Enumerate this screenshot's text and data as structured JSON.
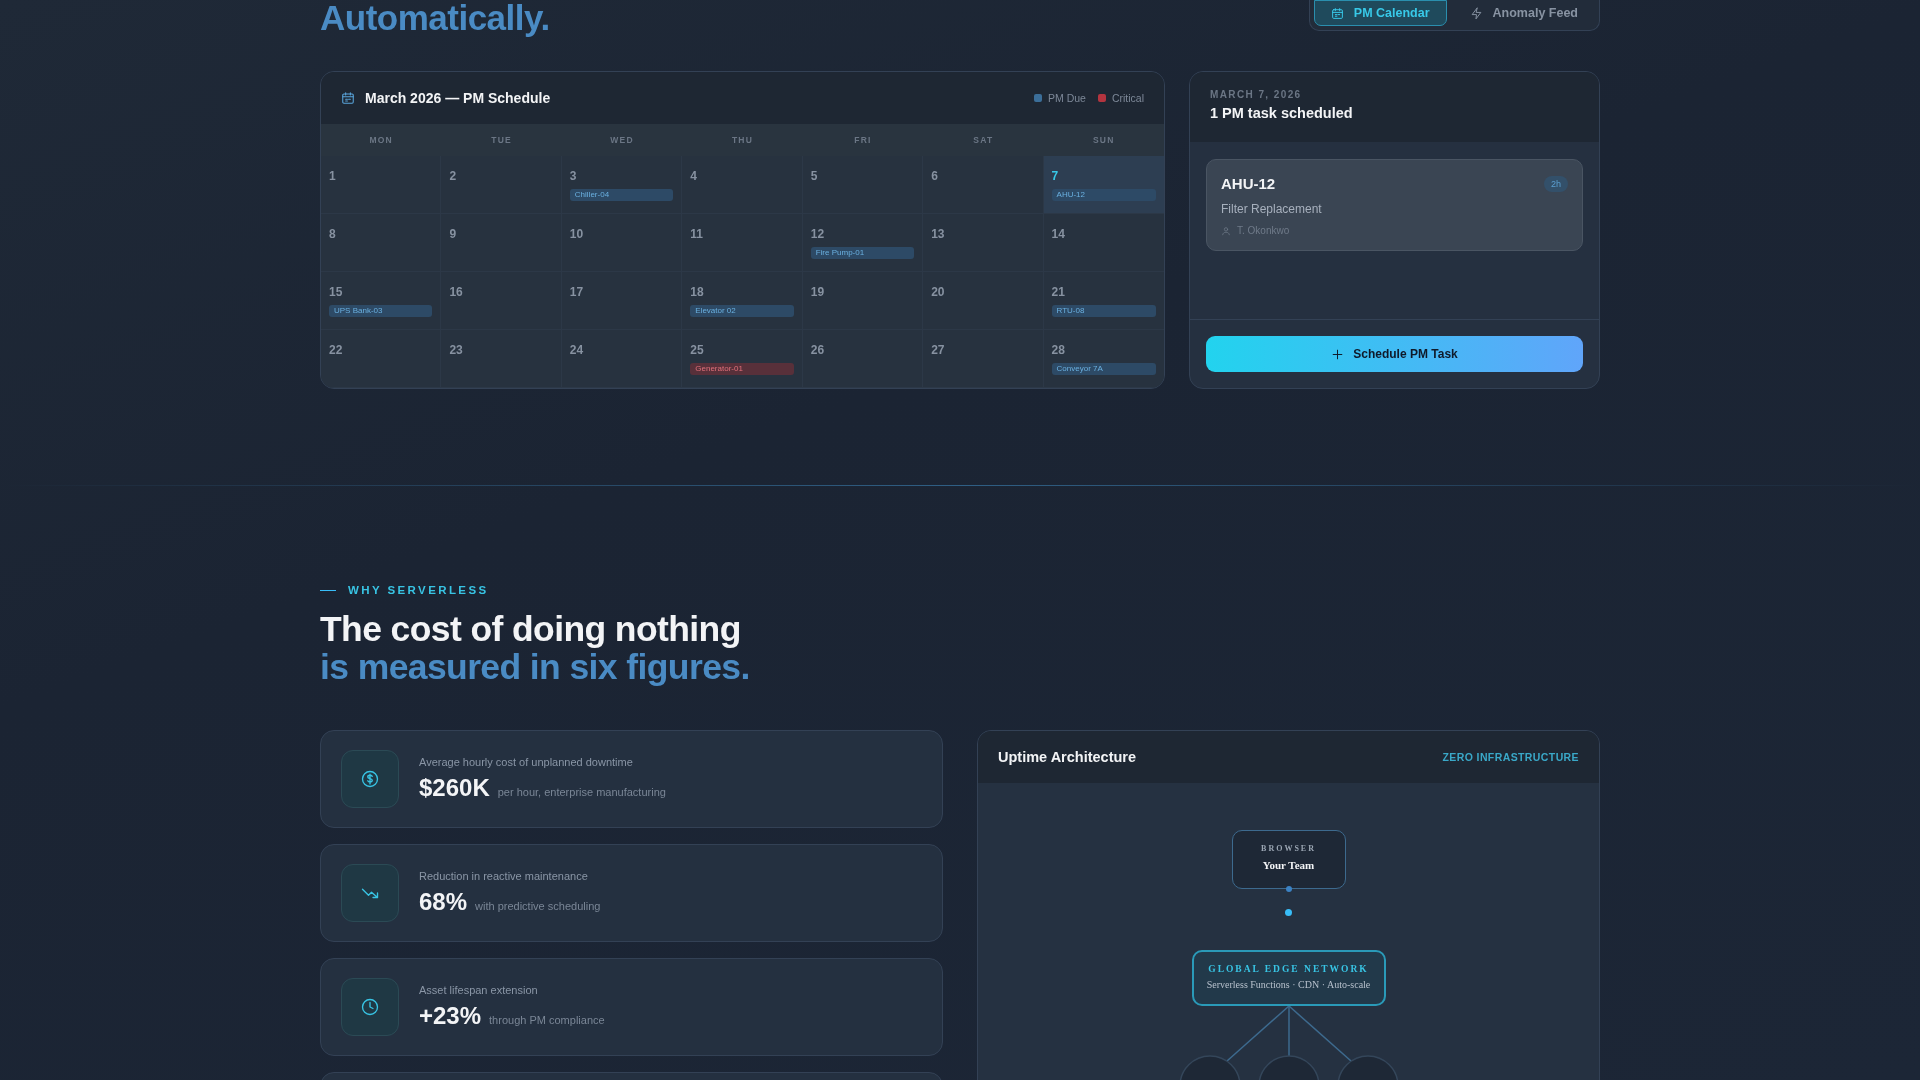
{
  "hero": {
    "heading": "Automatically."
  },
  "view_tabs": [
    {
      "label": "PM Calendar",
      "selected": true
    },
    {
      "label": "Anomaly Feed",
      "selected": false
    }
  ],
  "calendar": {
    "title": "March 2026 — PM Schedule",
    "legend": [
      {
        "label": "PM Due",
        "color": "#3b6e99"
      },
      {
        "label": "Critical",
        "color": "#b3343f"
      }
    ],
    "weekdays": [
      "MON",
      "TUE",
      "WED",
      "THU",
      "FRI",
      "SAT",
      "SUN"
    ],
    "days": [
      {
        "day": "1",
        "selected": false
      },
      {
        "day": "2",
        "selected": false
      },
      {
        "day": "3",
        "selected": false,
        "event": {
          "label": "Chiller-04",
          "kind": "pm"
        }
      },
      {
        "day": "4",
        "selected": false
      },
      {
        "day": "5",
        "selected": false
      },
      {
        "day": "6",
        "selected": false
      },
      {
        "day": "7",
        "selected": true,
        "event": {
          "label": "AHU-12",
          "kind": "pm"
        }
      },
      {
        "day": "8",
        "selected": false
      },
      {
        "day": "9",
        "selected": false
      },
      {
        "day": "10",
        "selected": false
      },
      {
        "day": "11",
        "selected": false
      },
      {
        "day": "12",
        "selected": false,
        "event": {
          "label": "Fire Pump-01",
          "kind": "pm"
        }
      },
      {
        "day": "13",
        "selected": false
      },
      {
        "day": "14",
        "selected": false
      },
      {
        "day": "15",
        "selected": false,
        "event": {
          "label": "UPS Bank-03",
          "kind": "pm"
        }
      },
      {
        "day": "16",
        "selected": false
      },
      {
        "day": "17",
        "selected": false
      },
      {
        "day": "18",
        "selected": false,
        "event": {
          "label": "Elevator 02",
          "kind": "pm"
        }
      },
      {
        "day": "19",
        "selected": false
      },
      {
        "day": "20",
        "selected": false
      },
      {
        "day": "21",
        "selected": false,
        "event": {
          "label": "RTU-08",
          "kind": "pm"
        }
      },
      {
        "day": "22",
        "selected": false
      },
      {
        "day": "23",
        "selected": false
      },
      {
        "day": "24",
        "selected": false
      },
      {
        "day": "25",
        "selected": false,
        "event": {
          "label": "Generator-01",
          "kind": "critical"
        }
      },
      {
        "day": "26",
        "selected": false
      },
      {
        "day": "27",
        "selected": false
      },
      {
        "day": "28",
        "selected": false,
        "event": {
          "label": "Conveyor 7A",
          "kind": "pm"
        }
      }
    ]
  },
  "day_panel": {
    "date": "MARCH 7, 2026",
    "summary": "1 PM task scheduled",
    "tasks": [
      {
        "asset": "AHU-12",
        "duration": "2h",
        "task": "Filter Replacement",
        "assignee": "T. Okonkwo"
      }
    ],
    "button": "Schedule PM Task"
  },
  "why": {
    "eyebrow": "WHY SERVERLESS",
    "heading_line1": "The cost of doing nothing",
    "heading_line2": "is measured in six figures."
  },
  "stats": [
    {
      "label": "Average hourly cost of unplanned downtime",
      "value": "$260K",
      "note": "per hour, enterprise manufacturing"
    },
    {
      "label": "Reduction in reactive maintenance",
      "value": "68%",
      "note": "with predictive scheduling"
    },
    {
      "label": "Asset lifespan extension",
      "value": "+23%",
      "note": "through PM compliance"
    }
  ],
  "architecture": {
    "title": "Uptime Architecture",
    "badge": "ZERO INFRASTRUCTURE",
    "nodes": [
      {
        "kind": "client",
        "caption": "BROWSER",
        "label": "Your Team"
      },
      {
        "kind": "edge",
        "caption": "GLOBAL EDGE NETWORK",
        "label": "Serverless Functions · CDN · Auto-scale"
      }
    ]
  }
}
